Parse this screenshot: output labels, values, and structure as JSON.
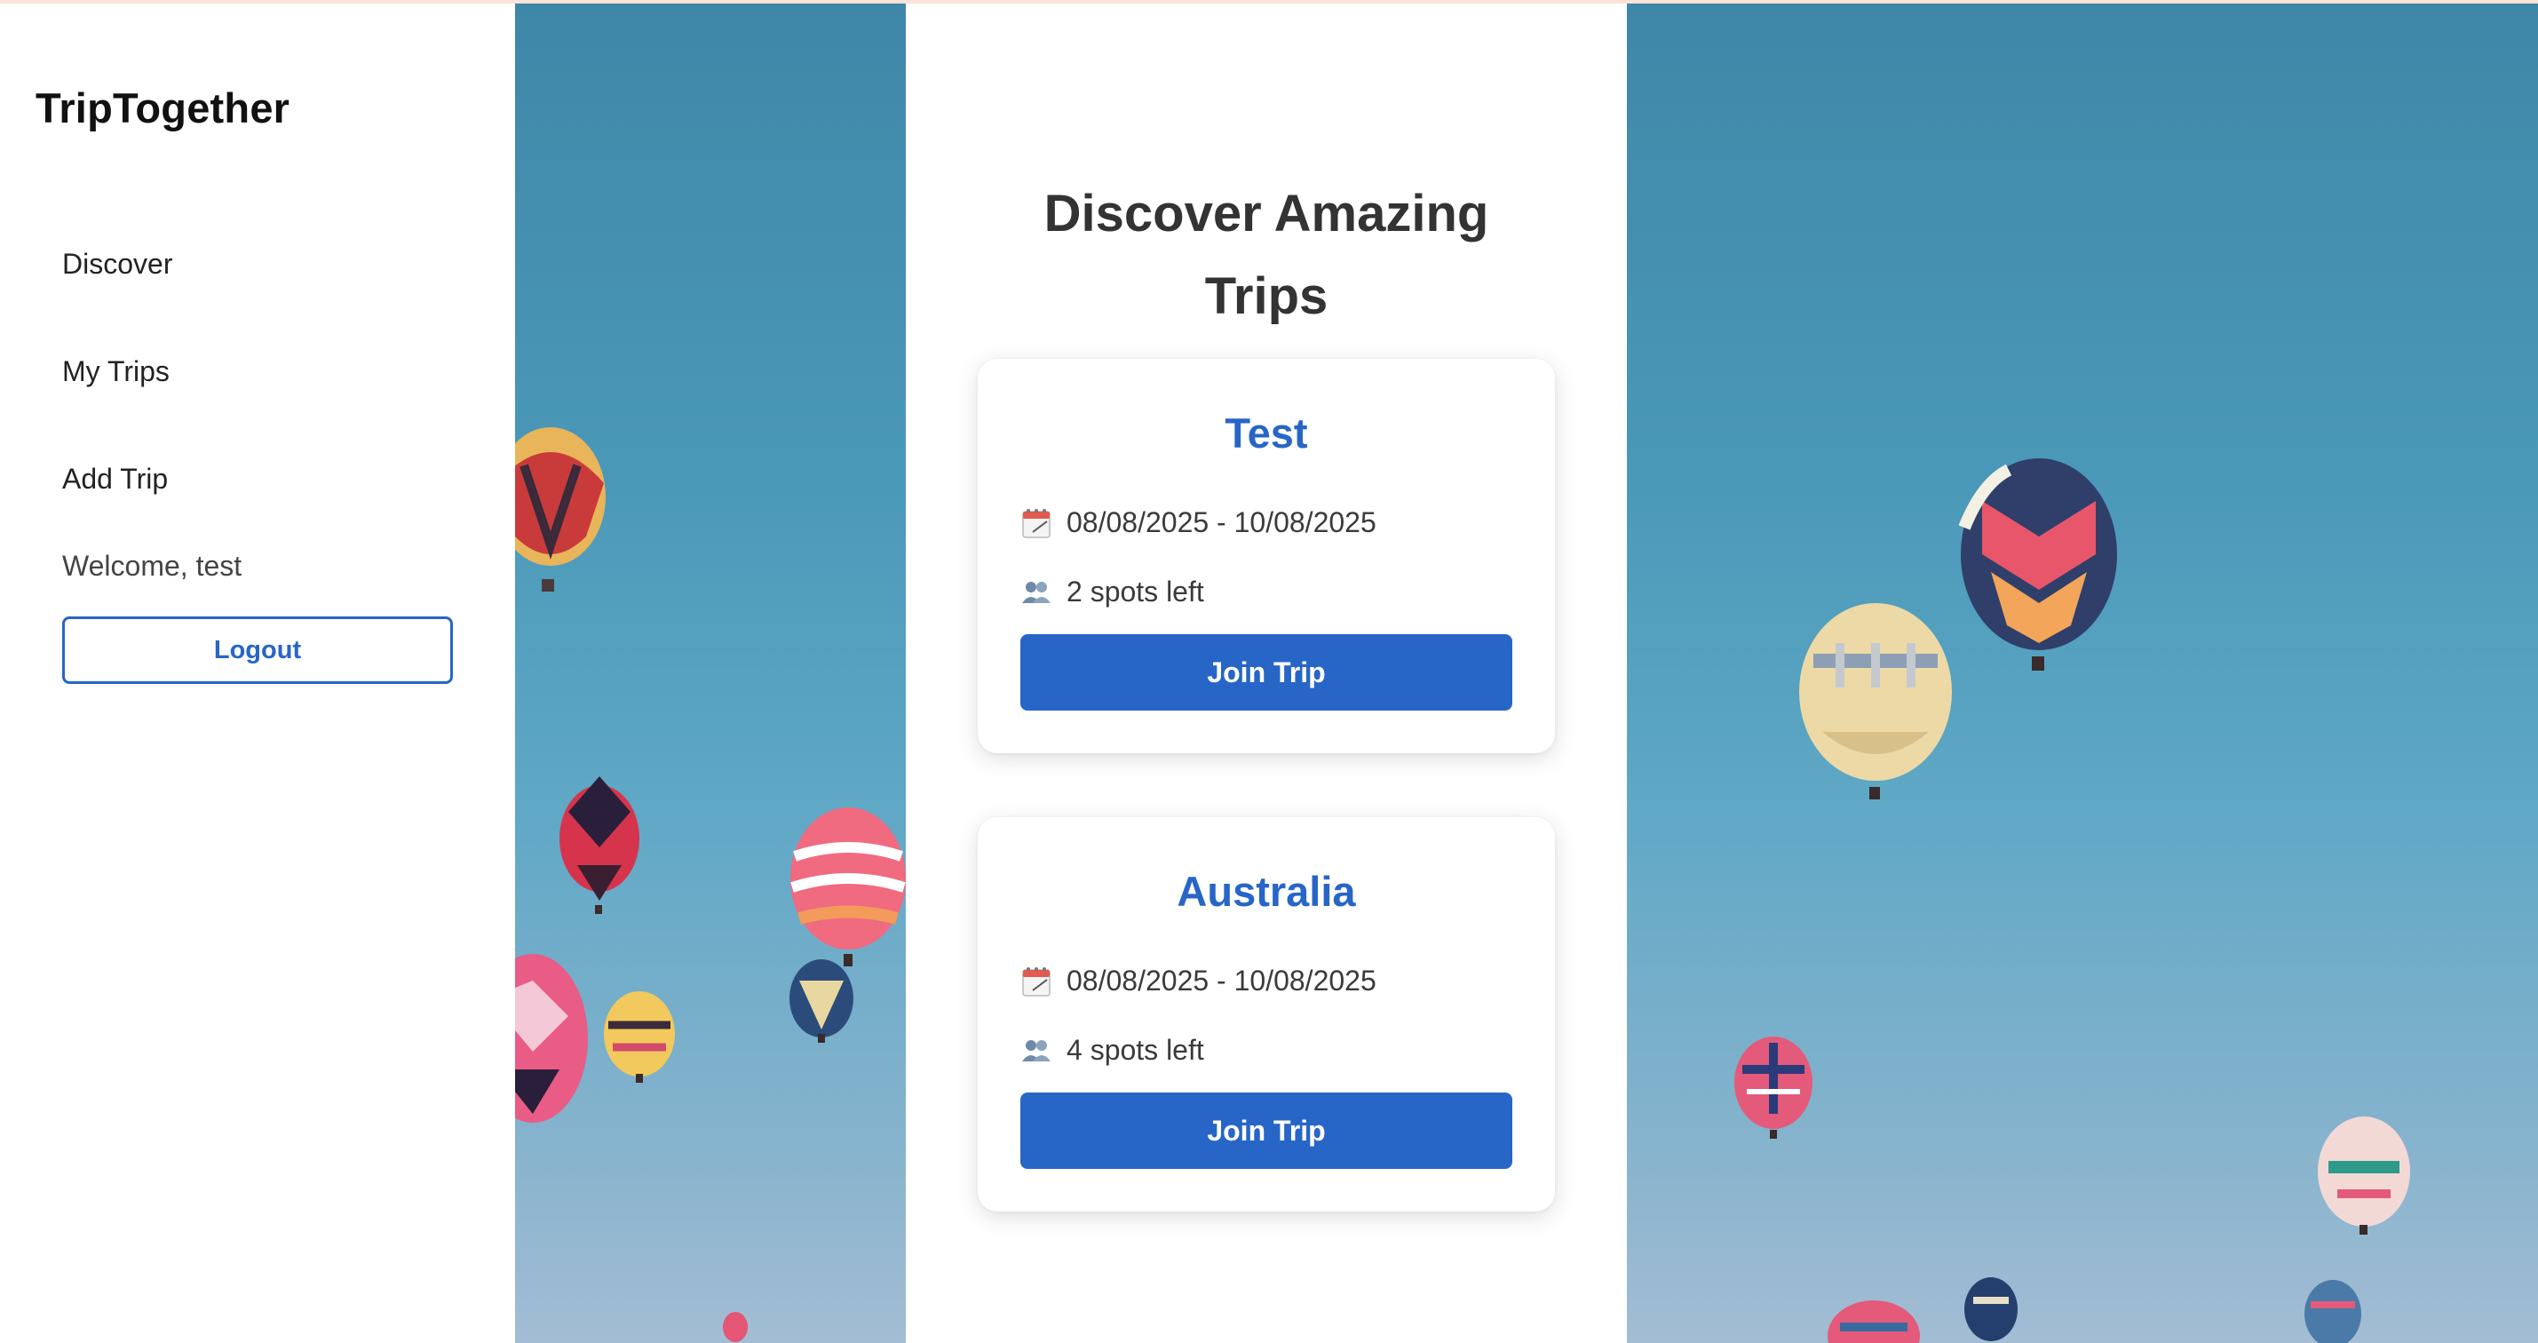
{
  "sidebar": {
    "brand": "TripTogether",
    "nav": [
      {
        "label": "Discover"
      },
      {
        "label": "My Trips"
      },
      {
        "label": "Add Trip"
      }
    ],
    "welcome": "Welcome, test",
    "logout_label": "Logout"
  },
  "feed": {
    "title": "Discover Amazing Trips",
    "trips": [
      {
        "name": "Test",
        "dates": "08/08/2025 - 10/08/2025",
        "spots": "2 spots left",
        "join_label": "Join Trip",
        "date_icon": "calendar-icon",
        "spots_icon": "people-icon"
      },
      {
        "name": "Australia",
        "dates": "08/08/2025 - 10/08/2025",
        "spots": "4 spots left",
        "join_label": "Join Trip",
        "date_icon": "calendar-icon",
        "spots_icon": "people-icon"
      }
    ]
  },
  "colors": {
    "accent": "#2766c6",
    "sky_top": "#3f87a8",
    "sky_bottom": "#a3bdd4"
  }
}
